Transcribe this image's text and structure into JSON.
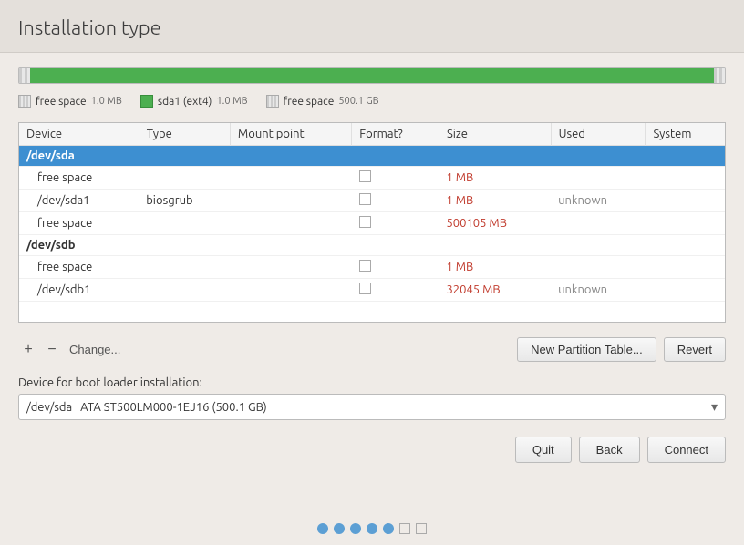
{
  "header": {
    "title": "Installation type"
  },
  "partition_bar": {
    "segments": [
      {
        "type": "unallocated",
        "width": "1.5%"
      },
      {
        "type": "ext4",
        "width": "97%"
      },
      {
        "type": "unallocated",
        "width": "1.5%"
      }
    ]
  },
  "partition_labels": [
    {
      "type": "unallocated",
      "label": "free space",
      "sub": "1.0 MB"
    },
    {
      "type": "ext4",
      "label": "sda1 (ext4)",
      "sub": "1.0 MB"
    },
    {
      "type": "unallocated",
      "label": "free space",
      "sub": "500.1 GB"
    }
  ],
  "table": {
    "columns": [
      "Device",
      "Type",
      "Mount point",
      "Format?",
      "Size",
      "Used",
      "System"
    ],
    "rows": [
      {
        "device": "/dev/sda",
        "type": "",
        "mount": "",
        "format": false,
        "size": "",
        "used": "",
        "system": "",
        "group": true,
        "selected": true
      },
      {
        "device": "free space",
        "type": "",
        "mount": "",
        "format": false,
        "size": "1 MB",
        "used": "",
        "system": "",
        "group": false,
        "selected": false
      },
      {
        "device": "/dev/sda1",
        "type": "biosgrub",
        "mount": "",
        "format": false,
        "size": "1 MB",
        "used": "unknown",
        "system": "",
        "group": false,
        "selected": false
      },
      {
        "device": "free space",
        "type": "",
        "mount": "",
        "format": false,
        "size": "500105 MB",
        "used": "",
        "system": "",
        "group": false,
        "selected": false
      },
      {
        "device": "/dev/sdb",
        "type": "",
        "mount": "",
        "format": false,
        "size": "",
        "used": "",
        "system": "",
        "group": true,
        "selected": false
      },
      {
        "device": "free space",
        "type": "",
        "mount": "",
        "format": false,
        "size": "1 MB",
        "used": "",
        "system": "",
        "group": false,
        "selected": false
      },
      {
        "device": "/dev/sdb1",
        "type": "",
        "mount": "",
        "format": false,
        "size": "32045 MB",
        "used": "unknown",
        "system": "",
        "group": false,
        "selected": false
      }
    ]
  },
  "toolbar": {
    "add_label": "+",
    "remove_label": "−",
    "change_label": "Change...",
    "new_partition_table_label": "New Partition Table...",
    "revert_label": "Revert"
  },
  "boot_loader": {
    "label": "Device for boot loader installation:",
    "value": "/dev/sda",
    "description": "ATA ST500LM000-1EJ16 (500.1 GB)"
  },
  "actions": {
    "quit_label": "Quit",
    "back_label": "Back",
    "connect_label": "Connect"
  },
  "footer": {
    "dots": [
      {
        "filled": true
      },
      {
        "filled": true
      },
      {
        "filled": true
      },
      {
        "filled": true
      },
      {
        "filled": true
      },
      {
        "filled": false
      },
      {
        "filled": false
      }
    ]
  }
}
